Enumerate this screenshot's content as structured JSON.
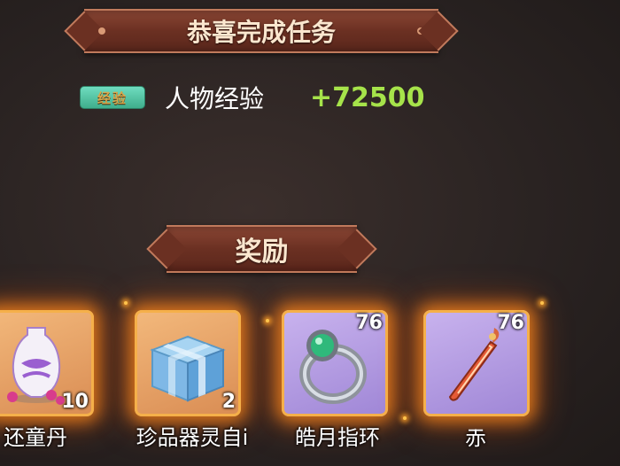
{
  "task_banner": {
    "title": "恭喜完成任务"
  },
  "experience": {
    "badge": "经验",
    "label": "人物经验",
    "value": "+72500"
  },
  "reward_banner": {
    "title": "奖励"
  },
  "rewards": [
    {
      "name": "还童丹",
      "count": "10",
      "count_position": "bottom-right",
      "rarity_color": "#e7a36a",
      "icon": "vase-icon"
    },
    {
      "name": "珍品器灵自i",
      "count": "2",
      "count_position": "bottom-right",
      "rarity_color": "#e7a36a",
      "icon": "gift-box-icon"
    },
    {
      "name": "皓月指环",
      "count": "76",
      "count_position": "top-right",
      "rarity_color": "#b39be3",
      "icon": "ring-icon"
    },
    {
      "name": "赤",
      "count": "76",
      "count_position": "top-right",
      "rarity_color": "#b39be3",
      "icon": "dagger-icon"
    }
  ],
  "colors": {
    "banner": "#6b3022",
    "exp_value": "#a6e34a",
    "glow": "#ff8c1e"
  }
}
